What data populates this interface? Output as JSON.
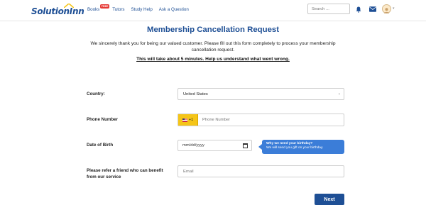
{
  "header": {
    "logo": "SolutionInn",
    "nav": [
      {
        "label": "Books",
        "badge": "FREE"
      },
      {
        "label": "Tutors"
      },
      {
        "label": "Study Help"
      },
      {
        "label": "Ask a Question"
      }
    ],
    "search_placeholder": "Search ...",
    "icons": [
      "search-icon",
      "bell-icon",
      "mail-icon",
      "user-avatar",
      "chevron-down-icon"
    ],
    "colors": {
      "brand": "#1e4f95",
      "accent": "#f5c518"
    }
  },
  "form": {
    "title": "Membership Cancellation Request",
    "intro": "We sincerely thank you for being our valued customer. Please fill out this form completely to process your membership cancellation request.",
    "notice": "This will take about 5 minutes. Help us understand what went wrong.",
    "country": {
      "label": "Country:",
      "value": "United States"
    },
    "phone": {
      "label": "Phone Number",
      "code": "+1",
      "placeholder": "Phone Number"
    },
    "dob": {
      "label": "Date of Birth",
      "placeholder": "mm/dd/yyyy",
      "tooltip_title": "Why we need your birthday?",
      "tooltip_body": "We will send you gift on your birthday."
    },
    "referral": {
      "label": "Please refer a friend who can benefit from our service",
      "placeholder": "Email"
    },
    "next_label": "Next"
  }
}
